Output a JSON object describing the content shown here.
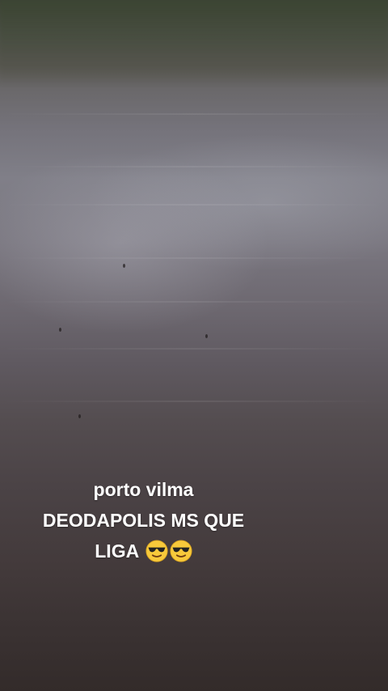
{
  "caption": {
    "line1": "porto vilma",
    "line2": "DEODAPOLIS MS QUE",
    "line3": "LIGA",
    "emojis": [
      "smiling-face-with-sunglasses-icon",
      "smiling-face-with-sunglasses-icon"
    ]
  },
  "colors": {
    "caption_text": "#ffffff",
    "water_light": "#807f88",
    "water_dark": "#332b2a",
    "bank_green": "#3d4336"
  }
}
